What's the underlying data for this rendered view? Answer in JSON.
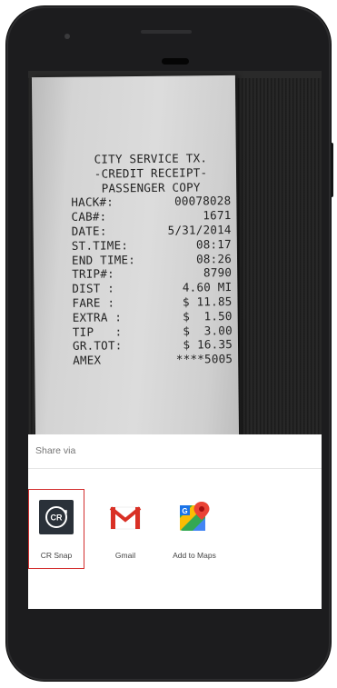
{
  "receipt": {
    "lines": [
      {
        "text": "CITY SERVICE TX.",
        "align": "center"
      },
      {
        "text": "-CREDIT RECEIPT-",
        "align": "center"
      },
      {
        "text": "PASSENGER COPY",
        "align": "center"
      },
      {
        "label": "HACK#:",
        "value": "00078028"
      },
      {
        "label": "CAB#:",
        "value": "1671"
      },
      {
        "label": "DATE:",
        "value": "5/31/2014"
      },
      {
        "label": "ST.TIME:",
        "value": "08:17"
      },
      {
        "label": "END TIME:",
        "value": "08:26"
      },
      {
        "label": "TRIP#:",
        "value": "8790"
      },
      {
        "label": "DIST :",
        "value": "4.60 MI"
      },
      {
        "label": "FARE :",
        "value": "$ 11.85"
      },
      {
        "label": "EXTRA :",
        "value": "$  1.50"
      },
      {
        "label": "TIP   :",
        "value": "$  3.00"
      },
      {
        "label": "GR.TOT:",
        "value": "$ 16.35"
      },
      {
        "label": "AMEX",
        "value": "****5005"
      }
    ]
  },
  "share_sheet": {
    "title": "Share via",
    "targets": [
      {
        "label": "CR Snap",
        "icon": "cr-snap-icon",
        "selected": true
      },
      {
        "label": "Gmail",
        "icon": "gmail-icon",
        "selected": false
      },
      {
        "label": "Add to Maps",
        "icon": "google-maps-icon",
        "selected": false
      }
    ]
  },
  "colors": {
    "selection_border": "#d32f2f",
    "phone_body": "#1c1c1e"
  }
}
